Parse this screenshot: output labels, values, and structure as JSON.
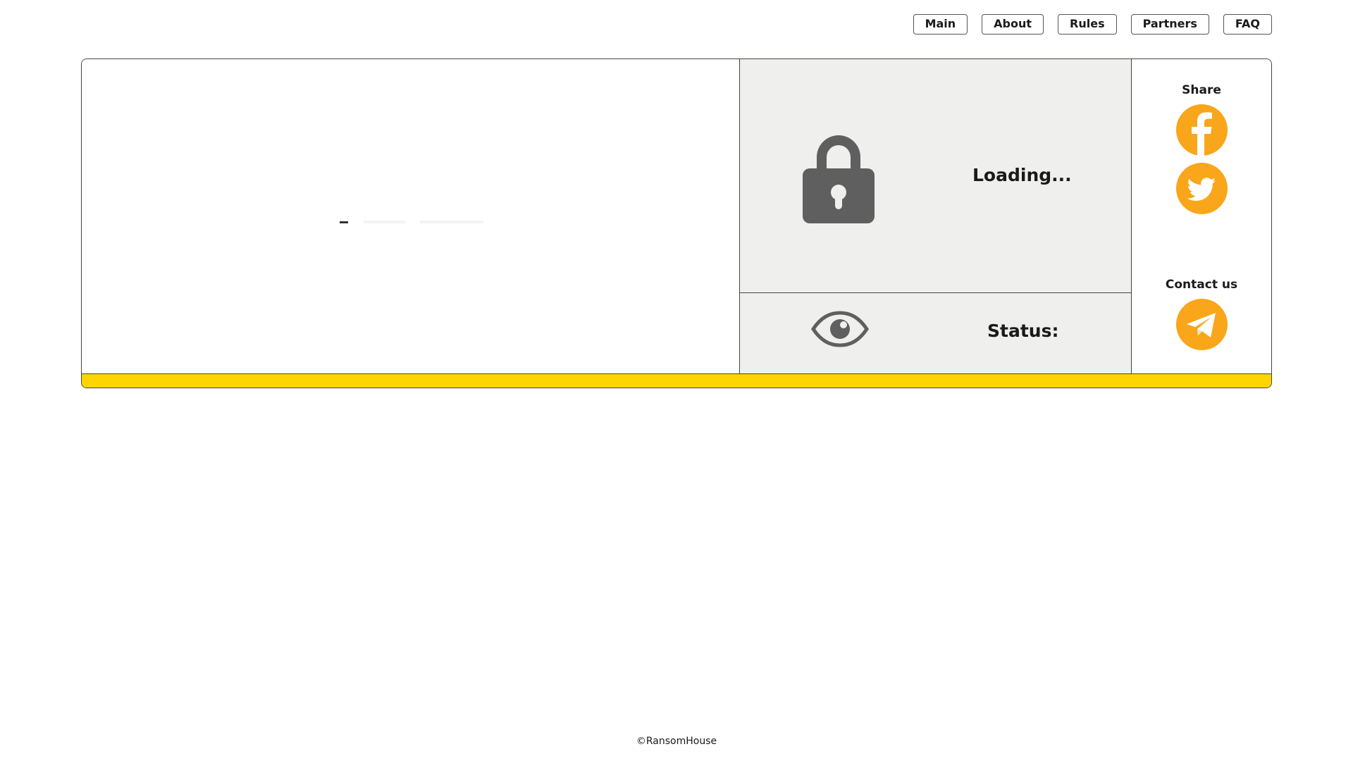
{
  "nav": {
    "items": [
      {
        "label": "Main"
      },
      {
        "label": "About"
      },
      {
        "label": "Rules"
      },
      {
        "label": "Partners"
      },
      {
        "label": "FAQ"
      }
    ]
  },
  "card": {
    "status_panel": {
      "loading_text": "Loading...",
      "status_label": "Status:",
      "lock_icon": "lock-icon",
      "eye_icon": "eye-icon"
    },
    "share": {
      "heading": "Share",
      "buttons": [
        {
          "icon": "facebook-icon"
        },
        {
          "icon": "twitter-icon"
        }
      ]
    },
    "contact": {
      "heading": "Contact us",
      "buttons": [
        {
          "icon": "telegram-icon"
        }
      ]
    }
  },
  "colors": {
    "accent_yellow": "#ffd500",
    "social_orange": "#f9a61b",
    "panel_gray": "#efefed",
    "icon_gray": "#5f5f5f"
  },
  "footer": {
    "copyright": "©RansomHouse"
  }
}
